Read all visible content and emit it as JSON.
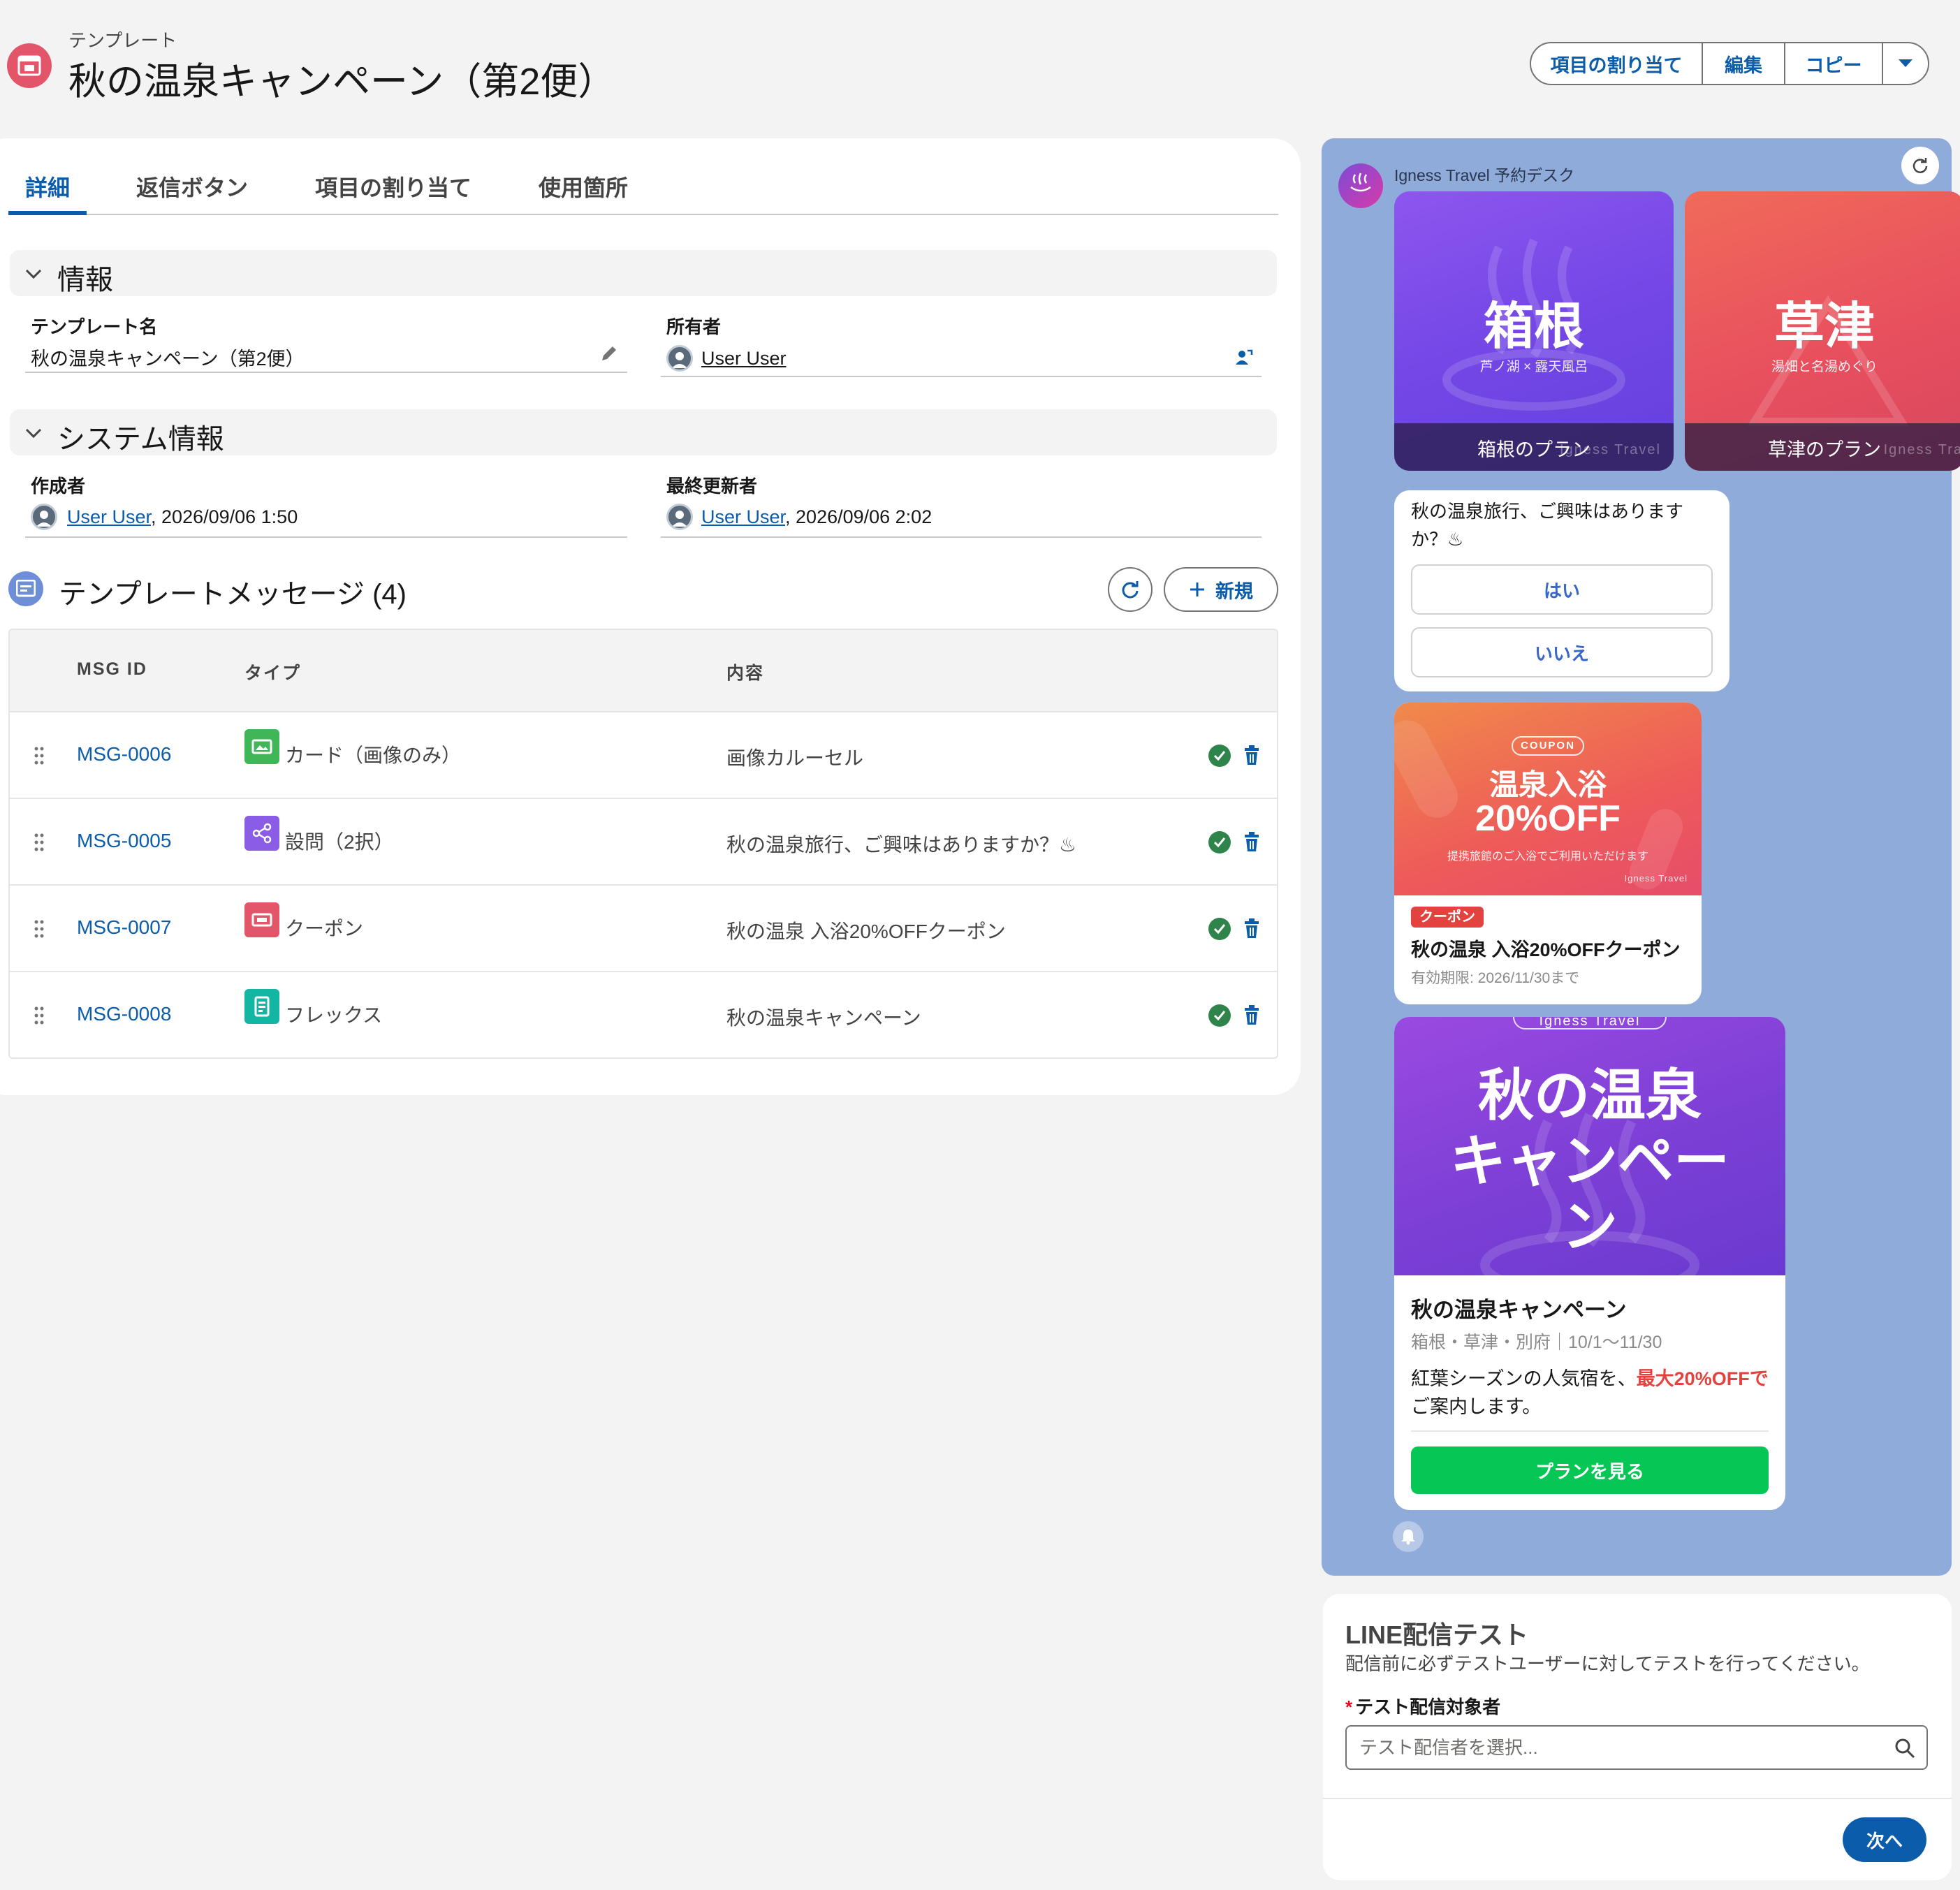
{
  "header": {
    "object_label": "テンプレート",
    "title": "秋の温泉キャンペーン（第2便）",
    "actions": {
      "assign": "項目の割り当て",
      "edit": "編集",
      "copy": "コピー"
    }
  },
  "tabs": [
    "詳細",
    "返信ボタン",
    "項目の割り当て",
    "使用箇所"
  ],
  "info": {
    "heading": "情報",
    "template_name_label": "テンプレート名",
    "template_name": "秋の温泉キャンペーン（第2便）",
    "owner_label": "所有者",
    "owner": "User User"
  },
  "system_info": {
    "heading": "システム情報",
    "created_by_label": "作成者",
    "created_by": "User User",
    "created_date": ", 2026/09/06 1:50",
    "modified_by_label": "最終更新者",
    "modified_by": "User User",
    "modified_date": ", 2026/09/06 2:02"
  },
  "messages": {
    "title": "テンプレートメッセージ (4)",
    "new_label": "新規",
    "columns": [
      "MSG ID",
      "タイプ",
      "内容"
    ],
    "rows": [
      {
        "id": "MSG-0006",
        "type": "カード（画像のみ）",
        "icon": "image-card-icon",
        "color": "#41b658",
        "content": "画像カルーセル"
      },
      {
        "id": "MSG-0005",
        "type": "設問（2択）",
        "icon": "branch-icon",
        "color": "#8b5ce6",
        "content": "秋の温泉旅行、ご興味はありますか？♨"
      },
      {
        "id": "MSG-0007",
        "type": "クーポン",
        "icon": "ticket-icon",
        "color": "#e3566a",
        "content": "秋の温泉 入浴20%OFFクーポン"
      },
      {
        "id": "MSG-0008",
        "type": "フレックス",
        "icon": "flex-layout-icon",
        "color": "#13b5a3",
        "content": "秋の温泉キャンペーン"
      }
    ]
  },
  "preview": {
    "account_name": "Igness Travel 予約デスク",
    "carousel": [
      {
        "title": "箱根",
        "subtitle": "芦ノ湖 × 露天風呂",
        "caption": "箱根のプラン",
        "watermark": "Igness Travel"
      },
      {
        "title": "草津",
        "subtitle": "湯畑と名湯めぐり",
        "caption": "草津のプラン",
        "watermark": "Igness Trav"
      }
    ],
    "question": {
      "text": "秋の温泉旅行、ご興味はありますか？♨",
      "options": [
        "はい",
        "いいえ"
      ]
    },
    "coupon": {
      "pill": "COUPON",
      "headline_1": "温泉入浴",
      "headline_2": "20%OFF",
      "note": "提携旅館のご入浴でご利用いただけます",
      "brand": "Igness Travel",
      "badge": "クーポン",
      "title": "秋の温泉 入浴20%OFFクーポン",
      "expiry": "有効期限: 2026/11/30まで"
    },
    "flex": {
      "brand": "Igness Travel",
      "hero_1": "秋の温泉",
      "hero_2": "キャンペー",
      "hero_3": "ン",
      "title": "秋の温泉キャンペーン",
      "meta": "箱根・草津・別府｜10/1〜11/30",
      "body_a": "紅葉シーズンの人気宿を、",
      "body_b": "最大20%OFF",
      "body_c": "で",
      "body_d": "ご案内します。",
      "button": "プランを見る"
    }
  },
  "line_test": {
    "title": "LINE配信テスト",
    "description": "配信前に必ずテストユーザーに対してテストを行ってください。",
    "target_label": "テスト配信対象者",
    "target_placeholder": "テスト配信者を選択...",
    "next": "次へ"
  },
  "colors": {
    "brand": "#0b5cab",
    "line_green": "#06c755",
    "preview_bg": "#8fabd9",
    "success": "#2e844a",
    "accent_red": "#e3566a"
  }
}
